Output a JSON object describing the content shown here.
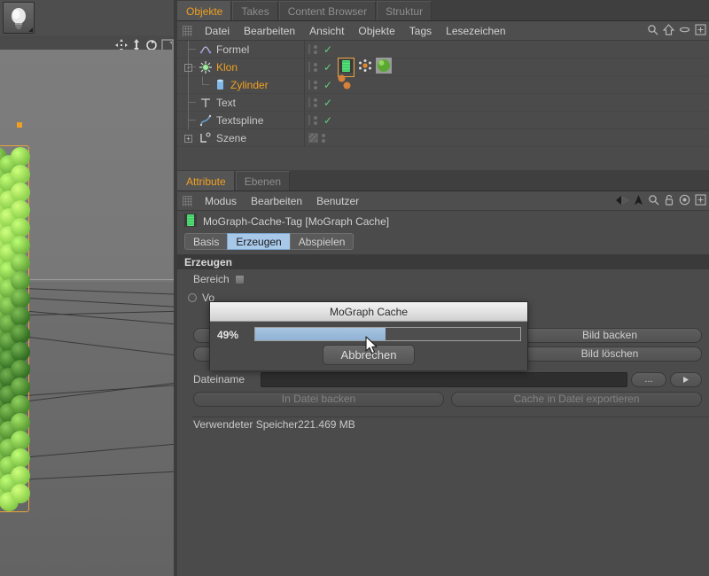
{
  "viewport": {
    "light_button": "light-bulb-button",
    "axis_icons": [
      "move-icon",
      "scale-icon",
      "rotate-icon",
      "world-axis-icon"
    ],
    "scene": {
      "clone_object": "green-sphere-clone-column",
      "selected": true,
      "grid": "perspective-floor-grid"
    }
  },
  "object_manager": {
    "tabs": [
      {
        "label": "Objekte",
        "active": true
      },
      {
        "label": "Takes",
        "active": false
      },
      {
        "label": "Content Browser",
        "active": false
      },
      {
        "label": "Struktur",
        "active": false
      }
    ],
    "menu": [
      "Datei",
      "Bearbeiten",
      "Ansicht",
      "Objekte",
      "Tags",
      "Lesezeichen"
    ],
    "toolbar_icons": [
      "search-icon",
      "home-icon",
      "ellipse-icon",
      "plus-box-icon"
    ],
    "rows": [
      {
        "label": "Formel",
        "icon": "formula-effector-icon",
        "indent": 1,
        "selected": false,
        "expander": "",
        "check": true,
        "tags": []
      },
      {
        "label": "Klon",
        "icon": "cloner-icon",
        "indent": 1,
        "selected": true,
        "expander": "-",
        "check": true,
        "tags": [
          "mograph-cache-tag",
          "cloner-tag",
          "material-tag"
        ]
      },
      {
        "label": "Zylinder",
        "icon": "cylinder-icon",
        "indent": 2,
        "selected": true,
        "expander": "",
        "check": true,
        "tags": [
          "dot-tag-a",
          "dot-tag-b"
        ]
      },
      {
        "label": "Text",
        "icon": "text-icon",
        "indent": 1,
        "selected": false,
        "expander": "",
        "check": true,
        "tags": []
      },
      {
        "label": "Textspline",
        "icon": "spline-icon",
        "indent": 1,
        "selected": false,
        "expander": "",
        "check": true,
        "tags": []
      },
      {
        "label": "Szene",
        "icon": "scene-layer-icon",
        "indent": 0,
        "selected": false,
        "expander": "+",
        "check": false,
        "tags": []
      }
    ]
  },
  "attribute_manager": {
    "tabs": [
      {
        "label": "Attribute",
        "active": true
      },
      {
        "label": "Ebenen",
        "active": false
      }
    ],
    "menu": [
      "Modus",
      "Bearbeiten",
      "Benutzer"
    ],
    "toolbar_icons": [
      "back-arrow-icon",
      "forward-arrow-icon",
      "up-arrow-icon",
      "search-icon",
      "lock-icon",
      "target-icon",
      "plus-box-icon"
    ],
    "object_title": "MoGraph-Cache-Tag [MoGraph Cache]",
    "object_icon": "mograph-cache-tag-icon",
    "param_tabs": [
      {
        "label": "Basis",
        "active": false
      },
      {
        "label": "Erzeugen",
        "active": true
      },
      {
        "label": "Abspielen",
        "active": false
      }
    ],
    "group_header": "Erzeugen",
    "bereich_label": "Bereich",
    "vo_label": "Vo",
    "bake_button": "Bild backen",
    "delete_button": "Bild löschen",
    "filename_label": "Dateiname",
    "filename_value": "",
    "browse_button": "...",
    "arrow_button": "play-arrow-icon",
    "bake_to_file_button": "In Datei backen",
    "export_cache_button": "Cache in Datei exportieren",
    "memory_label": "Verwendeter Speicher",
    "memory_value": "221.469 MB"
  },
  "modal": {
    "title": "MoGraph Cache",
    "percent_label": "49%",
    "percent_value": 49,
    "cancel_button": "Abbrechen",
    "progress_color": "#8fb2d6"
  }
}
